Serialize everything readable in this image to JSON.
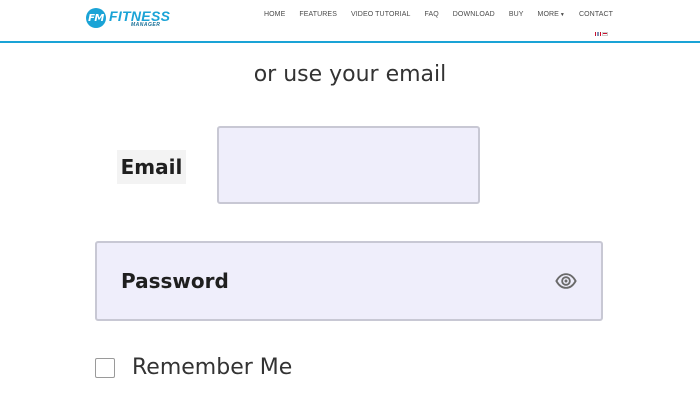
{
  "header": {
    "logo": {
      "badge": "FM",
      "name": "FITNESS",
      "sub": "MANAGER"
    },
    "nav": [
      {
        "label": "HOME"
      },
      {
        "label": "FEATURES"
      },
      {
        "label": "VIDEO TUTORIAL"
      },
      {
        "label": "FAQ"
      },
      {
        "label": "DOWNLOAD"
      },
      {
        "label": "BUY"
      },
      {
        "label": "MORE",
        "has_dropdown": true
      },
      {
        "label": "CONTACT"
      }
    ],
    "accent_color": "#1aa3d6"
  },
  "form": {
    "subtitle": "or use your email",
    "email": {
      "label": "Email",
      "value": "",
      "placeholder": ""
    },
    "password": {
      "value": "",
      "placeholder": "Password",
      "toggle_icon": "eye-icon"
    },
    "remember_me": {
      "label": "Remember Me",
      "checked": false
    }
  }
}
